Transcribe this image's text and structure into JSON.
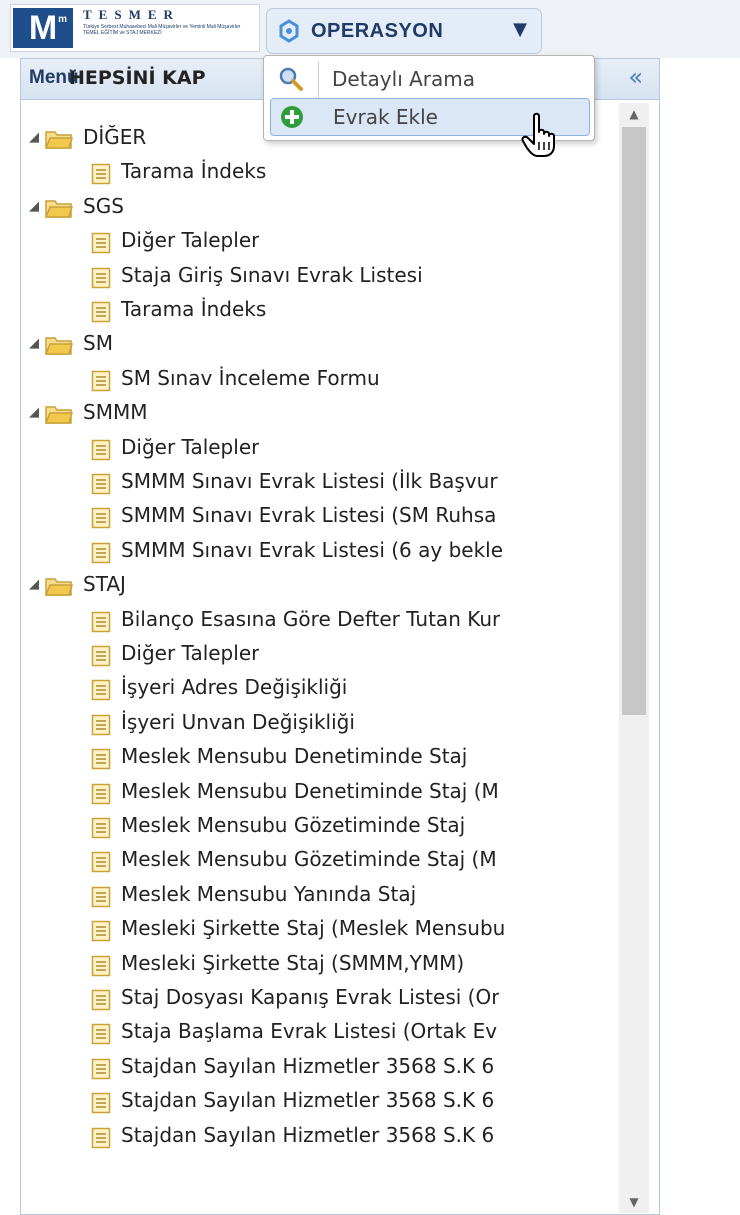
{
  "app": {
    "logo_letter": "M",
    "brand": "TESMER",
    "brand_subtitle": "Türkiye Serbest Muhasebeci Mali Müşavirler ve Yeminli Mali Müşavirler TEMEL EĞİTİM ve STAJ MERKEZİ"
  },
  "toolbar": {
    "operation_label": "OPERASYON",
    "operation_icon": "operation-icon"
  },
  "sidebar": {
    "title": "Menü",
    "collapse_glyph": "«",
    "collapse_all": "HEPSİNİ KAP",
    "tree": [
      {
        "type": "group",
        "label": "DİĞER"
      },
      {
        "type": "leaf",
        "label": "Tarama İndeks"
      },
      {
        "type": "group",
        "label": "SGS"
      },
      {
        "type": "leaf",
        "label": "Diğer Talepler"
      },
      {
        "type": "leaf",
        "label": "Staja Giriş Sınavı Evrak Listesi"
      },
      {
        "type": "leaf",
        "label": "Tarama İndeks"
      },
      {
        "type": "group",
        "label": "SM"
      },
      {
        "type": "leaf",
        "label": "SM Sınav İnceleme Formu"
      },
      {
        "type": "group",
        "label": "SMMM"
      },
      {
        "type": "leaf",
        "label": "Diğer Talepler"
      },
      {
        "type": "leaf",
        "label": "SMMM Sınavı Evrak Listesi (İlk Başvur"
      },
      {
        "type": "leaf",
        "label": "SMMM Sınavı Evrak Listesi (SM Ruhsa"
      },
      {
        "type": "leaf",
        "label": "SMMM Sınavı Evrak Listesi (6 ay bekle"
      },
      {
        "type": "group",
        "label": "STAJ"
      },
      {
        "type": "leaf",
        "label": "Bilanço Esasına Göre Defter Tutan Kur"
      },
      {
        "type": "leaf",
        "label": "Diğer Talepler"
      },
      {
        "type": "leaf",
        "label": "İşyeri Adres Değişikliği"
      },
      {
        "type": "leaf",
        "label": "İşyeri Unvan Değişikliği"
      },
      {
        "type": "leaf",
        "label": "Meslek Mensubu Denetiminde Staj"
      },
      {
        "type": "leaf",
        "label": "Meslek Mensubu Denetiminde Staj (M"
      },
      {
        "type": "leaf",
        "label": "Meslek Mensubu Gözetiminde Staj"
      },
      {
        "type": "leaf",
        "label": "Meslek Mensubu Gözetiminde Staj (M"
      },
      {
        "type": "leaf",
        "label": "Meslek Mensubu Yanında Staj"
      },
      {
        "type": "leaf",
        "label": "Mesleki Şirkette Staj (Meslek Mensubu"
      },
      {
        "type": "leaf",
        "label": "Mesleki Şirkette Staj (SMMM,YMM)"
      },
      {
        "type": "leaf",
        "label": "Staj Dosyası Kapanış Evrak Listesi (Or"
      },
      {
        "type": "leaf",
        "label": "Staja Başlama Evrak Listesi (Ortak Ev"
      },
      {
        "type": "leaf",
        "label": "Stajdan Sayılan Hizmetler 3568 S.K 6"
      },
      {
        "type": "leaf",
        "label": "Stajdan Sayılan Hizmetler 3568 S.K 6"
      },
      {
        "type": "leaf",
        "label": "Stajdan Sayılan Hizmetler 3568 S.K 6"
      }
    ]
  },
  "dropdown": {
    "items": [
      {
        "label": "Detaylı Arama",
        "icon": "search-icon"
      },
      {
        "label": "Evrak Ekle",
        "icon": "add-icon",
        "hovered": true
      }
    ]
  },
  "colors": {
    "brand_blue": "#1f3b66",
    "accent_blue": "#4a7bb5",
    "folder_yellow": "#f2c94c",
    "add_green": "#2e9d3a"
  }
}
